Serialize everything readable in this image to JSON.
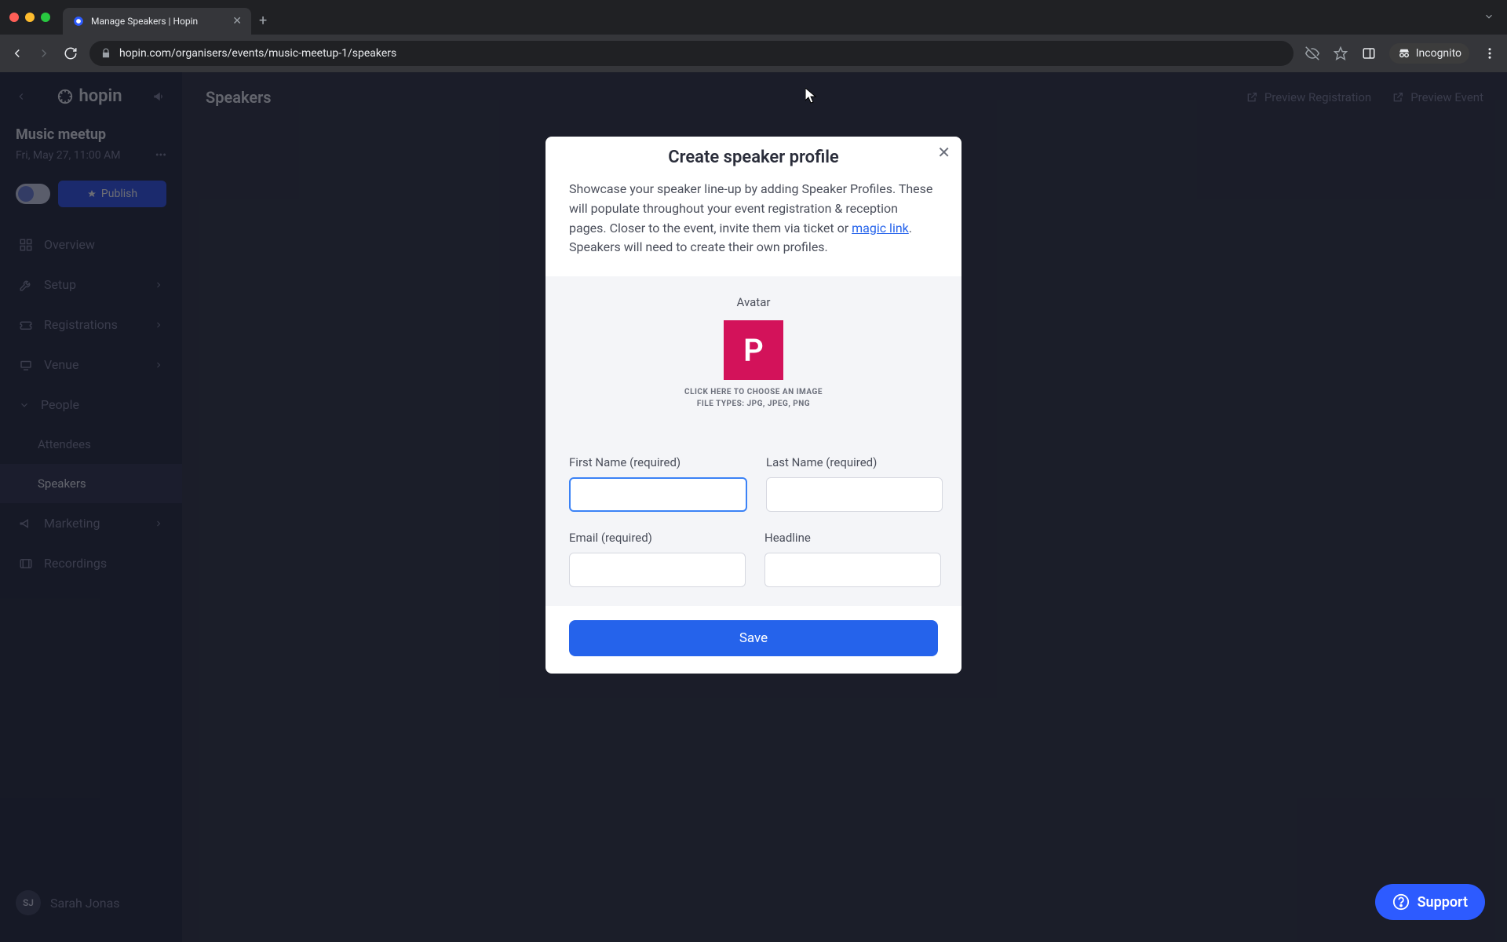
{
  "browser": {
    "tab_title": "Manage Speakers | Hopin",
    "url": "hopin.com/organisers/events/music-meetup-1/speakers",
    "incognito_label": "Incognito"
  },
  "sidebar": {
    "brand": "hopin",
    "event_name": "Music meetup",
    "event_datetime": "Fri, May 27, 11:00 AM",
    "publish_label": "Publish",
    "items": [
      {
        "label": "Overview",
        "icon": "grid-icon"
      },
      {
        "label": "Setup",
        "icon": "wrench-icon"
      },
      {
        "label": "Registrations",
        "icon": "ticket-icon"
      },
      {
        "label": "Venue",
        "icon": "stage-icon"
      },
      {
        "label": "People",
        "icon": "people-icon",
        "expanded": true
      },
      {
        "label": "Attendees",
        "sub": true
      },
      {
        "label": "Speakers",
        "sub": true,
        "active": true
      },
      {
        "label": "Marketing",
        "icon": "megaphone-icon"
      },
      {
        "label": "Recordings",
        "icon": "film-icon"
      }
    ],
    "user": {
      "initials": "SJ",
      "name": "Sarah Jonas"
    }
  },
  "header": {
    "page_title": "Speakers",
    "preview_registration": "Preview Registration",
    "preview_event": "Preview Event"
  },
  "modal": {
    "title": "Create speaker profile",
    "desc_before": "Showcase your speaker line-up by adding Speaker Profiles. These will populate throughout your event registration & reception pages. Closer to the event, invite them via ticket or ",
    "magic_link_text": "magic link",
    "desc_after": ". Speakers will need to create their own profiles.",
    "avatar_label": "Avatar",
    "avatar_letter": "P",
    "choose_image": "CLICK HERE TO CHOOSE AN IMAGE",
    "file_types": "FILE TYPES: JPG, JPEG, PNG",
    "fields": {
      "first_name": "First Name (required)",
      "last_name": "Last Name (required)",
      "email": "Email (required)",
      "headline": "Headline"
    },
    "save": "Save"
  },
  "support_label": "Support",
  "colors": {
    "accent": "#2563eb",
    "avatar_bg": "#d3125a"
  }
}
